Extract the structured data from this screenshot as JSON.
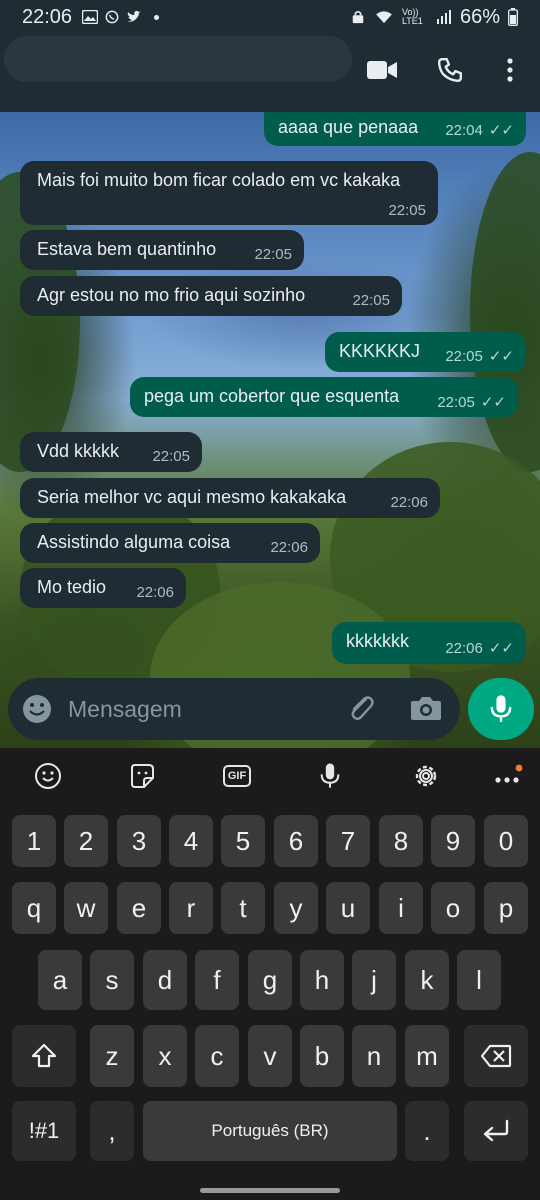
{
  "status_bar": {
    "time": "22:06",
    "battery": "66%",
    "lte": "Vo)) LTE1"
  },
  "header": {
    "icons": [
      "videocam-icon",
      "phone-icon",
      "more-vert-icon"
    ]
  },
  "messages": [
    {
      "dir": "out",
      "text": "aaaa que penaaa",
      "time": "22:04"
    },
    {
      "dir": "in",
      "text": "Mais foi muito bom ficar colado em vc kakaka",
      "time": "22:05"
    },
    {
      "dir": "in",
      "text": "Estava bem quantinho",
      "time": "22:05"
    },
    {
      "dir": "in",
      "text": "Agr estou no mo frio aqui sozinho",
      "time": "22:05"
    },
    {
      "dir": "out",
      "text": "KKKKKKJ",
      "time": "22:05"
    },
    {
      "dir": "out",
      "text": "pega um cobertor que esquenta",
      "time": "22:05"
    },
    {
      "dir": "in",
      "text": "Vdd kkkkk",
      "time": "22:05"
    },
    {
      "dir": "in",
      "text": "Seria melhor vc aqui mesmo kakakaka",
      "time": "22:06"
    },
    {
      "dir": "in",
      "text": "Assistindo alguma coisa",
      "time": "22:06"
    },
    {
      "dir": "in",
      "text": "Mo tedio",
      "time": "22:06"
    },
    {
      "dir": "out",
      "text": "kkkkkkk",
      "time": "22:06"
    }
  ],
  "composer": {
    "placeholder": "Mensagem"
  },
  "keyboard": {
    "toolbar": [
      "emoji-icon",
      "sticker-icon",
      "gif-icon",
      "mic-icon",
      "settings-icon",
      "more-horiz-icon"
    ],
    "gif_label": "GIF",
    "row_numbers": [
      "1",
      "2",
      "3",
      "4",
      "5",
      "6",
      "7",
      "8",
      "9",
      "0"
    ],
    "row_1": [
      "q",
      "w",
      "e",
      "r",
      "t",
      "y",
      "u",
      "i",
      "o",
      "p"
    ],
    "row_2": [
      "a",
      "s",
      "d",
      "f",
      "g",
      "h",
      "j",
      "k",
      "l"
    ],
    "row_3": [
      "z",
      "x",
      "c",
      "v",
      "b",
      "n",
      "m"
    ],
    "symbols_label": "!#1",
    "comma": ",",
    "space_label": "Português (BR)",
    "period": "."
  },
  "colors": {
    "accent": "#00a884",
    "out_bubble": "#005c4b",
    "in_bubble": "#202c33",
    "bar": "#1f2c34"
  }
}
